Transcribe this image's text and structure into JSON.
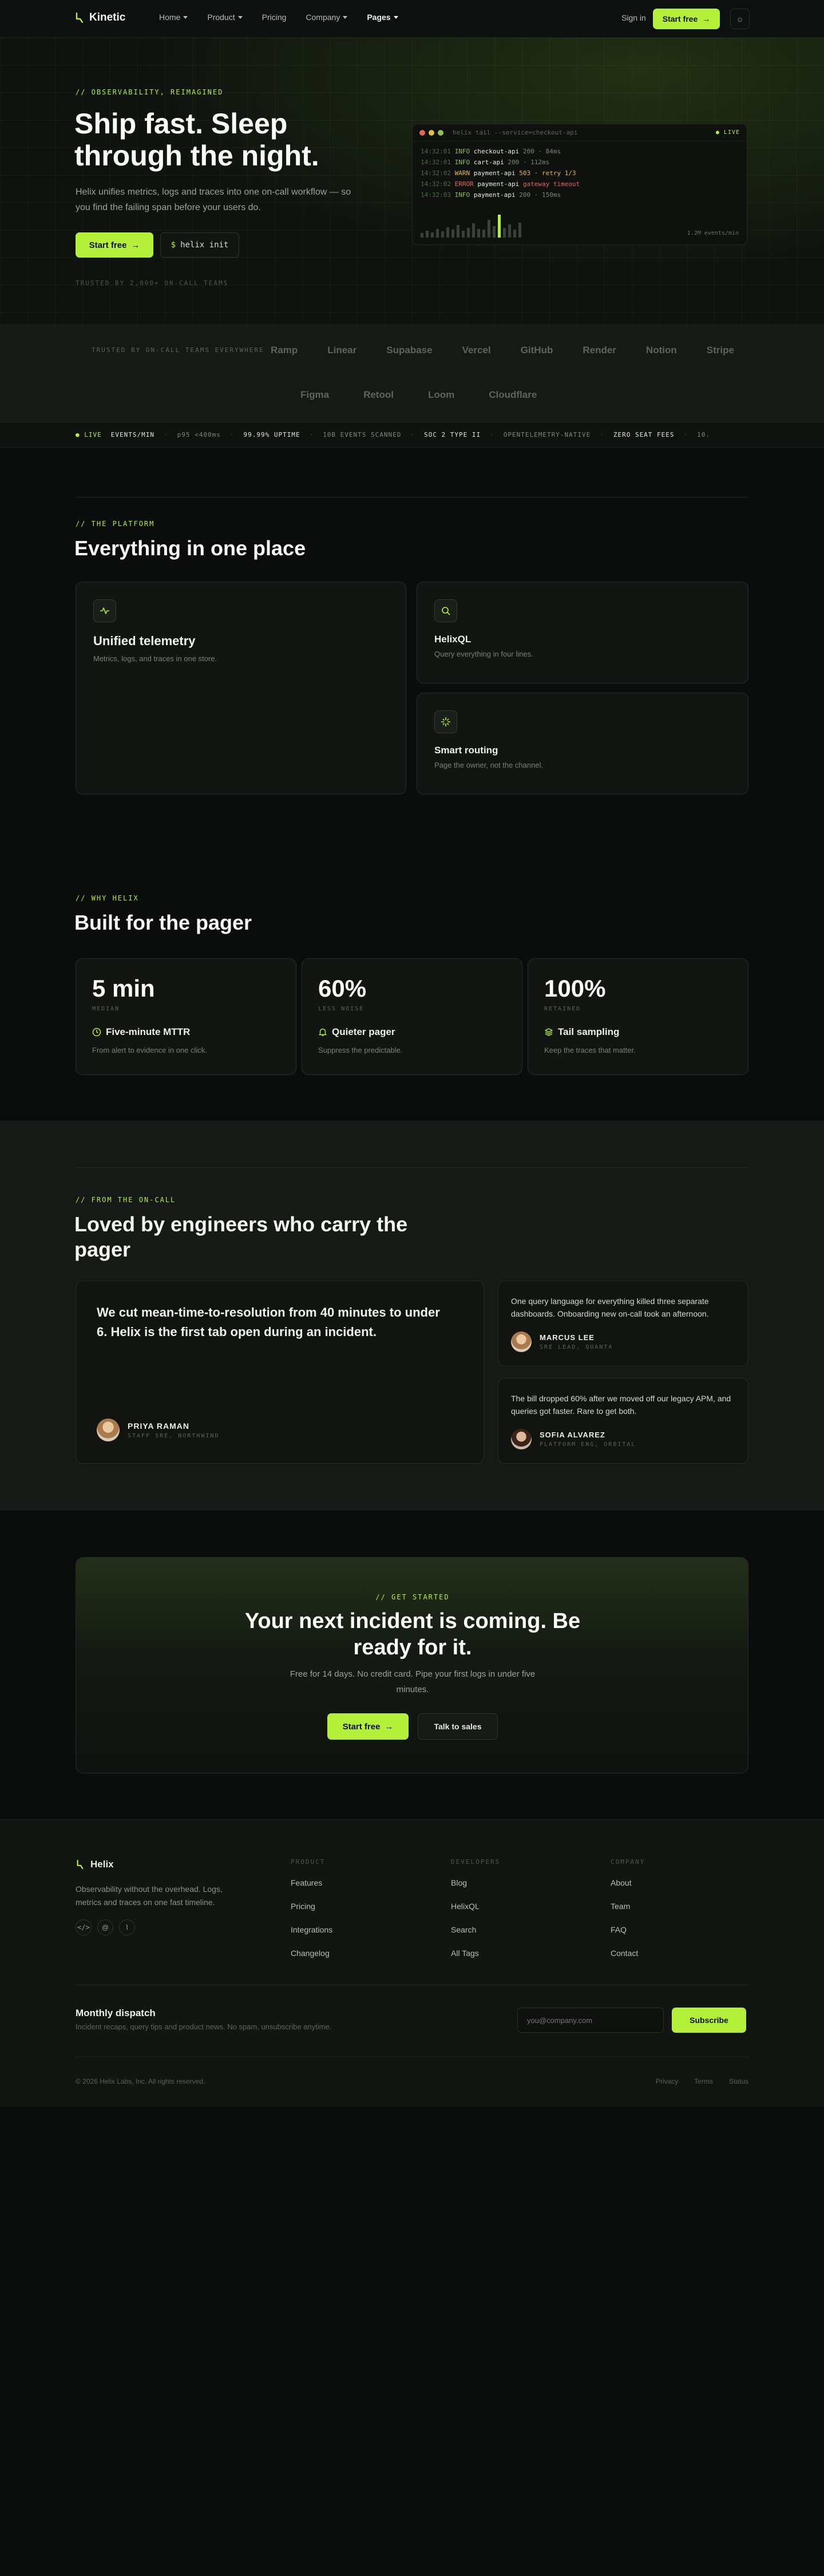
{
  "brand": {
    "name": "Kinetic",
    "accent": "#b4f03a",
    "icon": "bolt-icon"
  },
  "nav": {
    "links": [
      {
        "label": "Home",
        "caret": true
      },
      {
        "label": "Product",
        "caret": true
      },
      {
        "label": "Pricing",
        "caret": false
      },
      {
        "label": "Company",
        "caret": true
      },
      {
        "label": "Pages",
        "caret": true
      }
    ],
    "active": "Pages",
    "signin": "Sign in",
    "cta": "Start free",
    "theme_icon": "sun-icon"
  },
  "hero": {
    "eyebrow": "// OBSERVABILITY, REIMAGINED",
    "title": "Ship fast. Sleep through the night.",
    "lead": "Helix unifies metrics, logs and traces into one on-call workflow — so you find the failing span before your users do.",
    "cta_primary": "Start free",
    "cta_cmd": "helix init",
    "trusted": "TRUSTED BY 2,000+ ON-CALL TEAMS"
  },
  "terminal": {
    "title": "helix tail --service=checkout-api",
    "live": "LIVE",
    "logs": [
      {
        "ts": "14:32:01",
        "level": "INFO",
        "service": "checkout-api",
        "msg": "200 · 84ms"
      },
      {
        "ts": "14:32:01",
        "level": "INFO",
        "service": "cart-api",
        "msg": "200 · 112ms"
      },
      {
        "ts": "14:32:02",
        "level": "WARN",
        "service": "payment-api",
        "msg": "503 · retry 1/3"
      },
      {
        "ts": "14:32:02",
        "level": "ERROR",
        "service": "payment-api",
        "msg": "gateway timeout"
      },
      {
        "ts": "14:32:03",
        "level": "INFO",
        "service": "payment-api",
        "msg": "200 · 150ms"
      }
    ],
    "throughput": [
      5,
      8,
      6,
      10,
      7,
      12,
      9,
      14,
      8,
      11,
      16,
      10,
      9,
      20,
      13,
      26,
      11,
      15,
      9,
      17
    ],
    "highlight_index": 15,
    "rate": "1.2M events/min"
  },
  "logos": {
    "label": "TRUSTED BY ON-CALL TEAMS EVERYWHERE",
    "row1": [
      "Ramp",
      "Linear",
      "Supabase",
      "Vercel",
      "GitHub",
      "Render",
      "Notion",
      "Stripe"
    ],
    "row2": [
      "Figma",
      "Retool",
      "Loom",
      "Cloudflare"
    ]
  },
  "ticker": {
    "live": "LIVE",
    "items": [
      {
        "text": "EVENTS/MIN",
        "bold": true
      },
      {
        "text": "p95 <400ms",
        "bold": false
      },
      {
        "text": "99.99% UPTIME",
        "bold": true
      },
      {
        "text": "10B EVENTS SCANNED",
        "bold": false
      },
      {
        "text": "SOC 2 TYPE II",
        "bold": true
      },
      {
        "text": "OPENTELEMETRY-NATIVE",
        "bold": false
      },
      {
        "text": "ZERO SEAT FEES",
        "bold": true
      },
      {
        "text": "10.",
        "bold": false
      }
    ]
  },
  "platform": {
    "eyebrow": "// THE PLATFORM",
    "title": "Everything in one place",
    "cards": [
      {
        "icon": "pulse-icon",
        "title": "Unified telemetry",
        "desc": "Metrics, logs, and traces in one store."
      },
      {
        "icon": "search-icon",
        "title": "HelixQL",
        "desc": "Query everything in four lines."
      },
      {
        "icon": "sparkle-icon",
        "title": "Smart routing",
        "desc": "Page the owner, not the channel."
      }
    ]
  },
  "why": {
    "eyebrow": "// WHY HELIX",
    "title": "Built for the pager",
    "stats": [
      {
        "num": "5 min",
        "sub": "MEDIAN",
        "icon": "clock-icon",
        "head": "Five-minute MTTR",
        "desc": "From alert to evidence in one click."
      },
      {
        "num": "60%",
        "sub": "LESS NOISE",
        "icon": "bell-icon",
        "head": "Quieter pager",
        "desc": "Suppress the predictable."
      },
      {
        "num": "100%",
        "sub": "RETAINED",
        "icon": "layers-icon",
        "head": "Tail sampling",
        "desc": "Keep the traces that matter."
      }
    ]
  },
  "testimonials": {
    "eyebrow": "// FROM THE ON-CALL",
    "title": "Loved by engineers who carry the pager",
    "featured": {
      "quote": "We cut mean-time-to-resolution from 40 minutes to under 6. Helix is the first tab open during an incident.",
      "name": "PRIYA RAMAN",
      "role": "STAFF SRE, NORTHWIND"
    },
    "side": [
      {
        "quote": "One query language for everything killed three separate dashboards. Onboarding new on-call took an afternoon.",
        "name": "MARCUS LEE",
        "role": "SRE LEAD, QUANTA"
      },
      {
        "quote": "The bill dropped 60% after we moved off our legacy APM, and queries got faster. Rare to get both.",
        "name": "SOFIA ALVAREZ",
        "role": "PLATFORM ENG, ORBITAL"
      }
    ]
  },
  "cta": {
    "eyebrow": "// GET STARTED",
    "title": "Your next incident is coming. Be ready for it.",
    "body": "Free for 14 days. No credit card. Pipe your first logs in under five minutes.",
    "primary": "Start free",
    "secondary": "Talk to sales"
  },
  "footer": {
    "brand": "Helix",
    "tagline": "Observability without the overhead. Logs, metrics and traces on one fast timeline.",
    "socials": [
      "code-icon",
      "at-icon",
      "rss-icon"
    ],
    "cols": [
      {
        "head": "PRODUCT",
        "items": [
          "Features",
          "Pricing",
          "Integrations",
          "Changelog"
        ]
      },
      {
        "head": "DEVELOPERS",
        "items": [
          "Blog",
          "HelixQL",
          "Search",
          "All Tags"
        ]
      },
      {
        "head": "COMPANY",
        "items": [
          "About",
          "Team",
          "FAQ",
          "Contact"
        ]
      }
    ],
    "newsletter": {
      "title": "Monthly dispatch",
      "desc": "Incident recaps, query tips and product news. No spam, unsubscribe anytime.",
      "placeholder": "you@company.com",
      "button": "Subscribe"
    },
    "copyright": "© 2026 Helix Labs, Inc. All rights reserved.",
    "legal": [
      "Privacy",
      "Terms",
      "Status"
    ]
  }
}
